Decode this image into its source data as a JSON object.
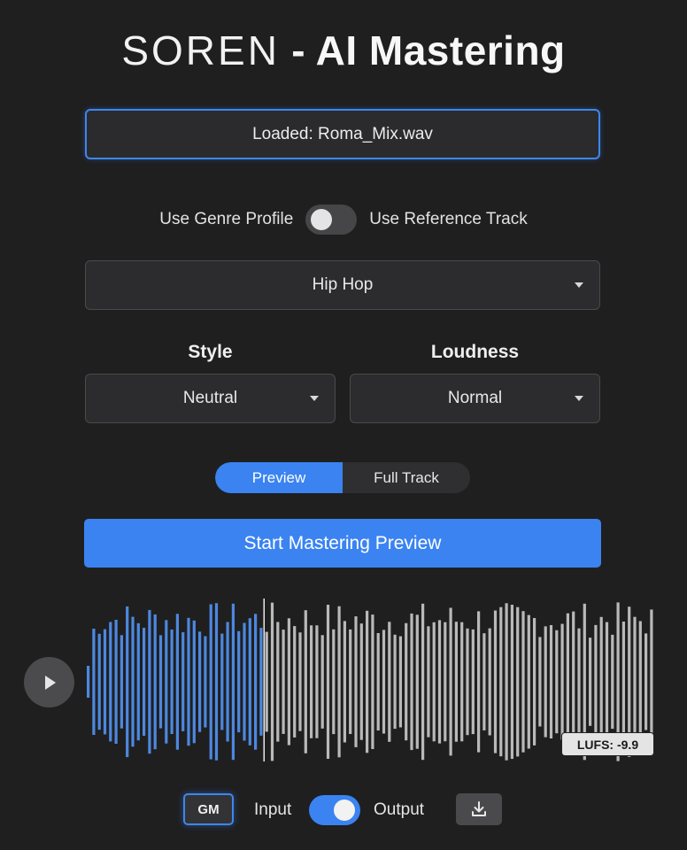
{
  "header": {
    "brand": "SOREN",
    "separator": " - ",
    "product": "AI Mastering"
  },
  "file": {
    "status_text": "Loaded: Roma_Mix.wav"
  },
  "mode": {
    "left_label": "Use Genre Profile",
    "right_label": "Use Reference Track",
    "toggle_state": "left"
  },
  "genre_select": {
    "selected": "Hip Hop",
    "caret_icon": "caret-down-icon"
  },
  "style": {
    "label": "Style",
    "selected": "Neutral"
  },
  "loudness": {
    "label": "Loudness",
    "selected": "Normal"
  },
  "render_mode": {
    "options": [
      "Preview",
      "Full Track"
    ],
    "active": "Preview"
  },
  "start_button": {
    "label": "Start Mastering Preview"
  },
  "player": {
    "play_icon": "play-icon",
    "playhead_fraction": 0.31,
    "lufs_text": "LUFS: -9.9",
    "colors": {
      "played": "#4d88df",
      "unplayed": "#b9b9b9",
      "playhead": "#e8e8e8"
    }
  },
  "bottom_bar": {
    "gm_label": "GM",
    "input_label": "Input",
    "output_label": "Output",
    "io_toggle_state": "output",
    "download_icon": "download-icon"
  },
  "theme": {
    "accent": "#3a83f1",
    "background": "#1f1f20"
  }
}
